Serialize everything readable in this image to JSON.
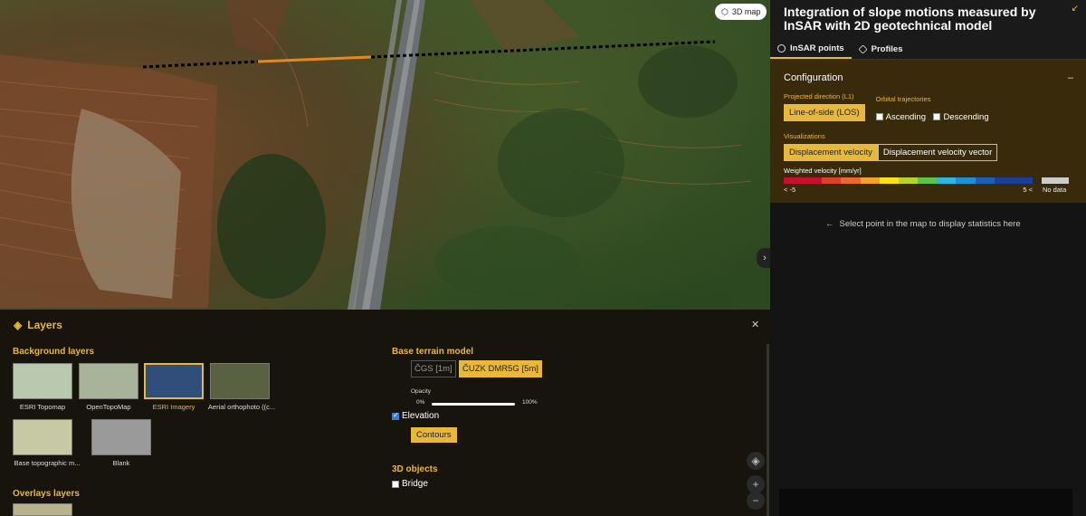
{
  "map": {
    "btn_3d": "3D map"
  },
  "panel": {
    "title": "Integration of slope motions measured by InSAR with 2D geotechnical model",
    "tabs": [
      {
        "label": "InSAR points",
        "icon": "circle-icon"
      },
      {
        "label": "Profiles",
        "icon": "pentagon-icon"
      }
    ],
    "config": {
      "title": "Configuration",
      "min_icon": "–",
      "projected_label": "Projected direction (L1)",
      "projected_value": "Line-of-side (LOS)",
      "orbital_label": "Orbital trajectories",
      "ascending": "Ascending",
      "descending": "Descending",
      "visualizations_label": "Visualizations",
      "vis_option_1": "Displacement velocity",
      "vis_option_2": "Displacement velocity vector",
      "legend_title": "Weighted velocity [mm/yr]",
      "legend_min": "< -5",
      "legend_max": "5 <",
      "nodata": "No data",
      "colors": [
        "#c8102e",
        "#c8102e",
        "#d9412b",
        "#e86a2c",
        "#f2a22b",
        "#f8e11a",
        "#b7d42a",
        "#5cc44a",
        "#2db6e0",
        "#1f8fd6",
        "#1b5fb8",
        "#1a3f9a",
        "#1a3f9a"
      ]
    },
    "stats_msg": "Select point in the map to display statistics here"
  },
  "layers": {
    "title": "Layers",
    "background_title": "Background layers",
    "thumbs": [
      {
        "label": "ESRI Topomap",
        "color": "#b9c9b0"
      },
      {
        "label": "OpenTopoMap",
        "color": "#a9b39a"
      },
      {
        "label": "ESRI Imagery",
        "color": "#2f4e7a"
      },
      {
        "label": "Aerial orthophoto ((c...",
        "color": "#5a6042"
      },
      {
        "label": "Base topographic m...",
        "color": "#c7c9a4"
      },
      {
        "label": "Blank",
        "color": "#9a9a9a"
      }
    ],
    "overlays_title": "Overlays layers",
    "terrain_title": "Base terrain model",
    "terrain_opt1": "ČGS [1m]",
    "terrain_opt2": "ČUZK DMR5G [5m]",
    "opacity_label": "Opacity",
    "opacity_min": "0%",
    "opacity_max": "100%",
    "elevation": "Elevation",
    "contours": "Contours",
    "objects_title": "3D objects",
    "bridge": "Bridge"
  }
}
